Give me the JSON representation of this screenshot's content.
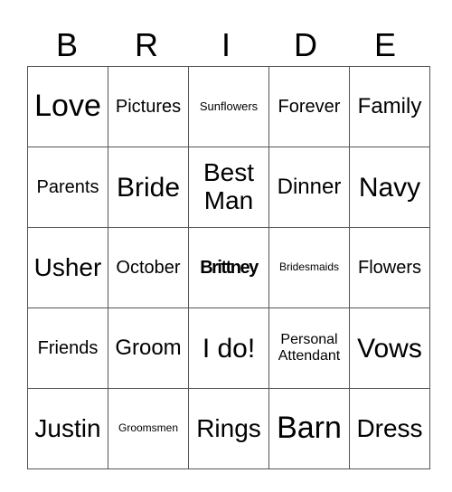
{
  "header": [
    "B",
    "R",
    "I",
    "D",
    "E"
  ],
  "cells": [
    [
      "Love",
      "Pictures",
      "Sunflowers",
      "Forever",
      "Family"
    ],
    [
      "Parents",
      "Bride",
      "Best Man",
      "Dinner",
      "Navy"
    ],
    [
      "Usher",
      "October",
      "Brittney",
      "Bridesmaids",
      "Flowers"
    ],
    [
      "Friends",
      "Groom",
      "I do!",
      "Personal Attendant",
      "Vows"
    ],
    [
      "Justin",
      "Groomsmen",
      "Rings",
      "Barn",
      "Dress"
    ]
  ]
}
